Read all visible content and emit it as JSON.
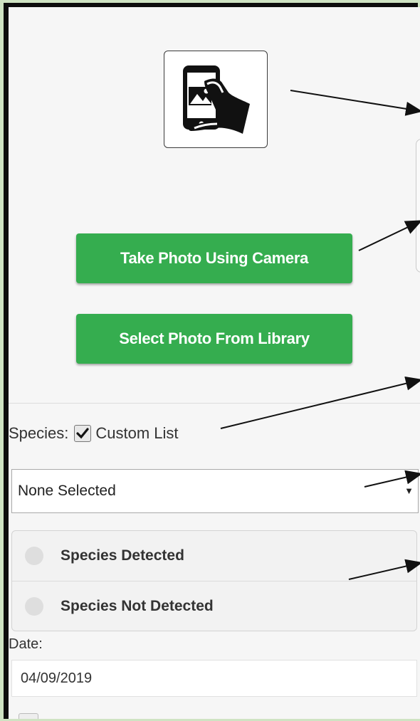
{
  "photo_icon": {
    "icon": "hand-holding-phone-photo-icon"
  },
  "buttons": {
    "take_photo": "Take Photo Using Camera",
    "select_photo": "Select Photo From Library"
  },
  "species": {
    "label": "Species:",
    "custom_list_label": "Custom List",
    "custom_list_checked": true,
    "selected": "None Selected"
  },
  "detection": {
    "options": [
      "Species Detected",
      "Species Not Detected"
    ]
  },
  "date": {
    "label": "Date:",
    "value": "04/09/2019"
  },
  "colors": {
    "accent": "#35ad4f",
    "frame": "#0d0d0d",
    "background": "#f6f6f6"
  }
}
